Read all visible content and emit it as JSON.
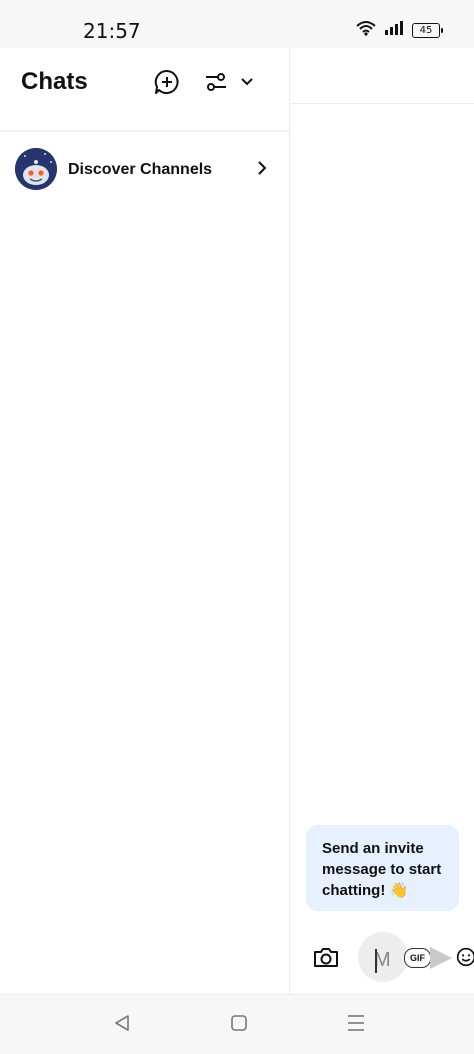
{
  "status_bar": {
    "time": "21:57",
    "battery_level": "45",
    "icons": [
      "wifi-icon",
      "signal-icon",
      "battery-icon"
    ]
  },
  "left_pane": {
    "title": "Chats",
    "header_icons": [
      "new-chat-icon",
      "filter-icon",
      "chevron-down-icon"
    ],
    "channels": [
      {
        "label": "Discover Channels",
        "avatar": "reddit-avatar",
        "chevron": "chevron-right-icon"
      }
    ]
  },
  "right_pane": {
    "bubble_text": "Send an invite message to start chatting! 👋",
    "composer": {
      "ring_text": "M",
      "gif_label": "GIF",
      "icons": [
        "camera-icon",
        "gif-icon",
        "send-arrow-icon",
        "emoji-icon"
      ]
    }
  },
  "navbar": {
    "icons": [
      "back-icon",
      "home-icon",
      "menu-icon"
    ]
  },
  "colors": {
    "bubble_bg": "#e7f0fe",
    "bar_bg": "#f7f7f8",
    "avatar_bg": "#27356f"
  }
}
